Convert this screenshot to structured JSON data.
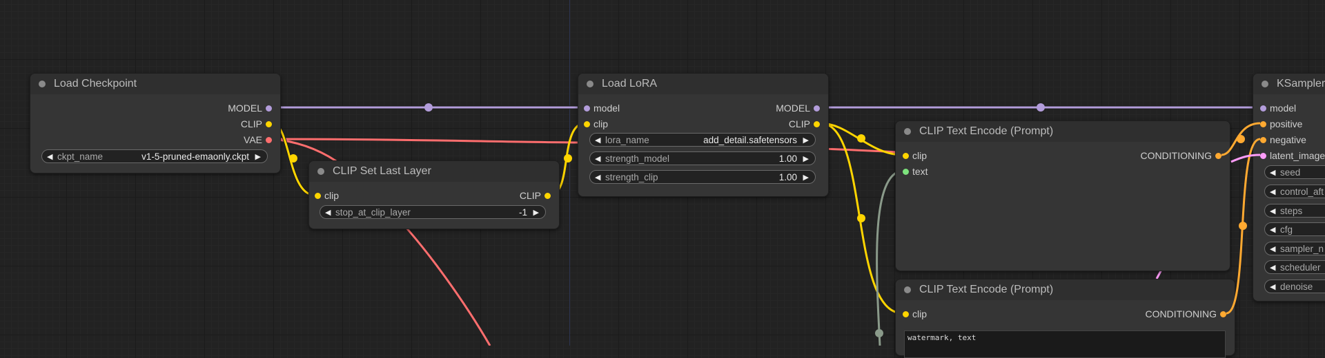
{
  "colors": {
    "model": "#b39ddb",
    "clip": "#ffd500",
    "vae": "#ff6e6e",
    "conditioning": "#ffa931",
    "latent": "#ff9cf9",
    "text": "#7de37d"
  },
  "nodes": {
    "load_checkpoint": {
      "title": "Load Checkpoint",
      "outputs": [
        "MODEL",
        "CLIP",
        "VAE"
      ],
      "widgets": [
        {
          "label": "ckpt_name",
          "value": "v1-5-pruned-emaonly.ckpt"
        }
      ]
    },
    "clip_set_last_layer": {
      "title": "CLIP Set Last Layer",
      "input": "clip",
      "output": "CLIP",
      "widgets": [
        {
          "label": "stop_at_clip_layer",
          "value": "-1"
        }
      ]
    },
    "load_lora": {
      "title": "Load LoRA",
      "inputs": [
        "model",
        "clip"
      ],
      "outputs": [
        "MODEL",
        "CLIP"
      ],
      "widgets": [
        {
          "label": "lora_name",
          "value": "add_detail.safetensors"
        },
        {
          "label": "strength_model",
          "value": "1.00"
        },
        {
          "label": "strength_clip",
          "value": "1.00"
        }
      ]
    },
    "clip_text_encode_1": {
      "title": "CLIP Text Encode (Prompt)",
      "inputs": [
        "clip",
        "text"
      ],
      "output": "CONDITIONING"
    },
    "clip_text_encode_2": {
      "title": "CLIP Text Encode (Prompt)",
      "input": "clip",
      "output": "CONDITIONING",
      "text": "watermark, text"
    },
    "ksampler": {
      "title": "KSampler",
      "inputs": [
        "model",
        "positive",
        "negative",
        "latent_image"
      ],
      "widgets": [
        "seed",
        "control_aft",
        "steps",
        "cfg",
        "sampler_n",
        "scheduler",
        "denoise"
      ]
    }
  }
}
